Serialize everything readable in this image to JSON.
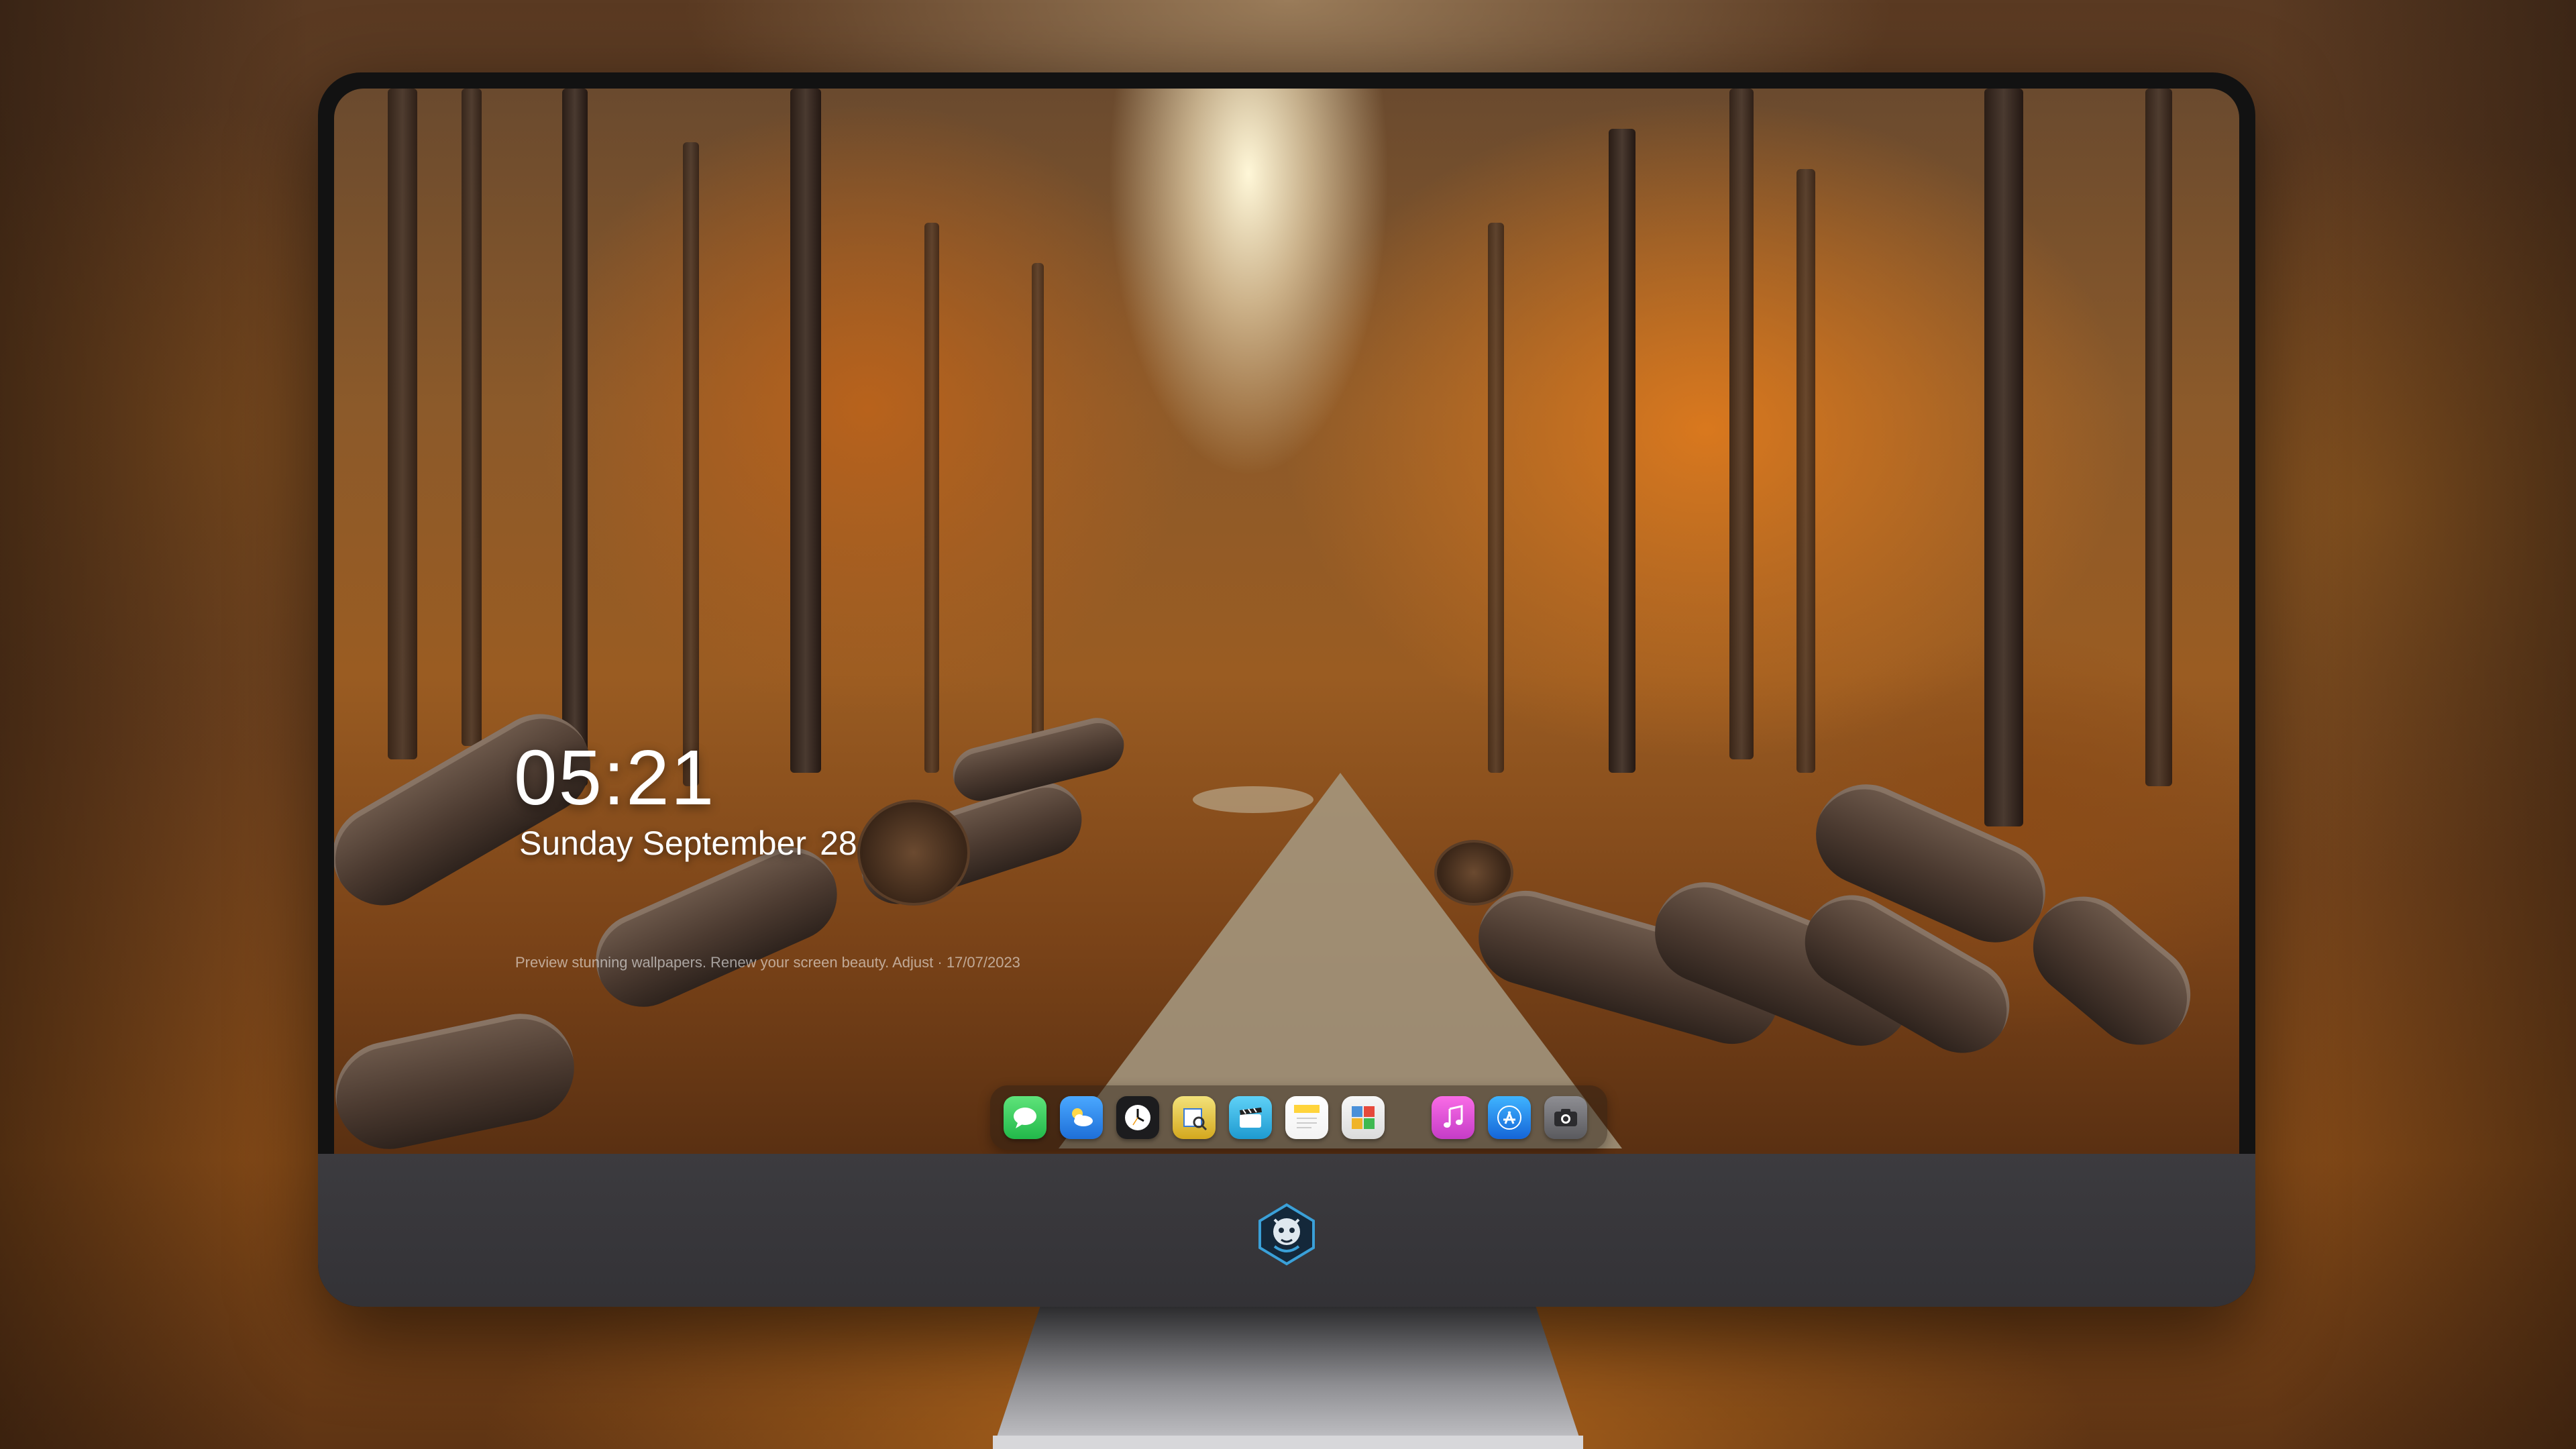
{
  "lockscreen": {
    "time": "05:21",
    "weekday_month": "Sunday September",
    "day": "28",
    "caption": "Preview stunning wallpapers. Renew your screen beauty. Adjust · 17/07/2023"
  },
  "dock": {
    "apps": [
      {
        "name": "Messages",
        "icon": "messages-icon",
        "color": "#34c759"
      },
      {
        "name": "Weather",
        "icon": "weather-icon",
        "color": "#2f8cf0"
      },
      {
        "name": "Clock",
        "icon": "clock-icon",
        "color": "#1c1c1e"
      },
      {
        "name": "Preview",
        "icon": "preview-icon",
        "color": "#e9c94a"
      },
      {
        "name": "Clips",
        "icon": "clips-icon",
        "color": "#36b4e6"
      },
      {
        "name": "Notes",
        "icon": "notes-icon",
        "color": "#ffd43b"
      },
      {
        "name": "Photo Booth",
        "icon": "photo-booth-icon",
        "color": "#4a90d9"
      },
      {
        "name": "Music",
        "icon": "music-icon",
        "color": "#e64bd6"
      },
      {
        "name": "App Store",
        "icon": "app-store-icon",
        "color": "#1e88f0"
      },
      {
        "name": "Camera",
        "icon": "camera-icon",
        "color": "#6a6a6e"
      }
    ]
  },
  "logo": {
    "icon": "dragon-logo-icon",
    "color": "#3aa0d8"
  }
}
